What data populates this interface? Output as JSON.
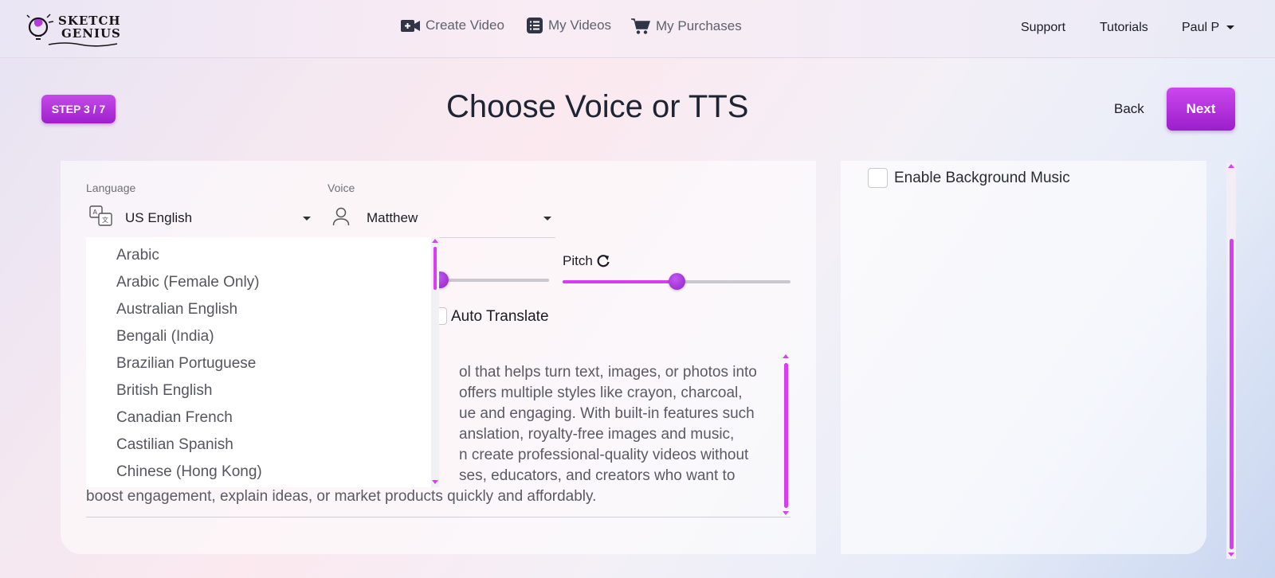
{
  "header": {
    "logo_line1": "SKETCH",
    "logo_line2": "GENIUS",
    "nav": {
      "create_video": "Create Video",
      "my_videos": "My Videos",
      "my_purchases": "My Purchases"
    },
    "support": "Support",
    "tutorials": "Tutorials",
    "user": "Paul P"
  },
  "page": {
    "step_badge": "STEP 3 / 7",
    "title": "Choose Voice or TTS",
    "back_label": "Back",
    "next_label": "Next"
  },
  "language": {
    "label": "Language",
    "selected": "US English",
    "options": [
      "Arabic",
      "Arabic (Female Only)",
      "Australian English",
      "Bengali (India)",
      "Brazilian Portuguese",
      "British English",
      "Canadian French",
      "Castilian Spanish",
      "Chinese (Hong Kong)"
    ]
  },
  "voice": {
    "label": "Voice",
    "selected": "Matthew"
  },
  "pitch": {
    "label": "Pitch",
    "value_fraction": 0.5
  },
  "speed": {
    "value_fraction": 0.03
  },
  "auto_translate": {
    "label": "Auto Translate",
    "checked": false
  },
  "script_text": {
    "lines": [
      "ol that helps turn text, images, or photos into",
      "offers multiple styles like crayon, charcoal,",
      "ue and engaging. With built-in features such",
      "anslation, royalty-free images and music,",
      "n create professional-quality videos without",
      "ses, educators, and creators who want to",
      "boost engagement, explain ideas, or market products quickly and affordably."
    ]
  },
  "background_music": {
    "label": "Enable Background Music",
    "checked": false
  },
  "colors": {
    "accent": "#b12fe0",
    "slider_fill": "#d83cf0",
    "title": "#1e2433"
  }
}
